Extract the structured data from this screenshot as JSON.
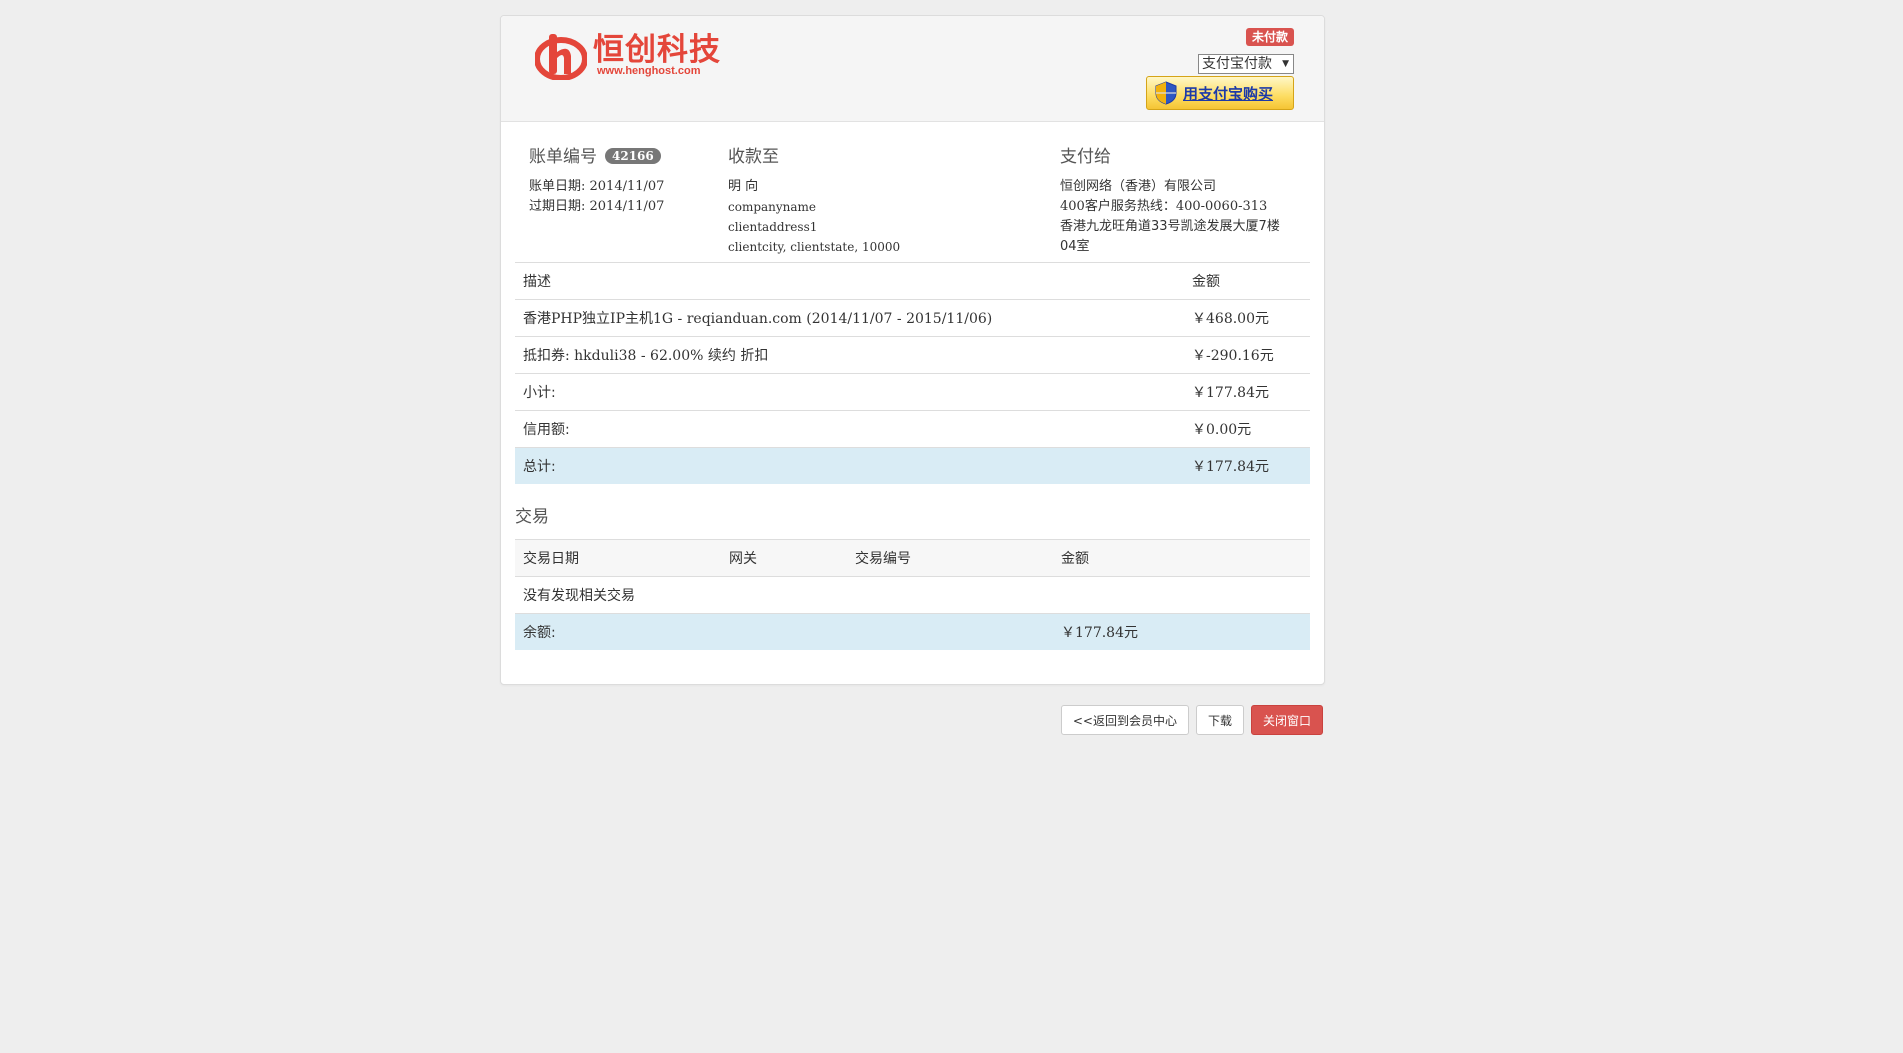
{
  "header": {
    "logo_name": "恒创科技",
    "logo_url": "www.henghost.com",
    "status": "未付款",
    "payment_method": "支付宝付款",
    "alipay_button": "用支付宝购买",
    "colors": {
      "brand": "#e4463a",
      "status": "#d9534f",
      "alipay_text": "#1c3aa8"
    }
  },
  "invoice": {
    "number_label": "账单编号",
    "number": "42166",
    "date_line": "账单日期: 2014/11/07",
    "due_line": "过期日期: 2014/11/07"
  },
  "bill_to": {
    "title": "收款至",
    "name": "明 向",
    "company": "companyname",
    "address": "clientaddress1",
    "city_line": "clientcity, clientstate, 10000"
  },
  "pay_to": {
    "title": "支付给",
    "company": "恒创网络（香港）有限公司",
    "hotline": "400客户服务热线：400-0060-313",
    "address_1": "香港九龙旺角道33号凯途发展大厦7楼",
    "address_2": "04室"
  },
  "items_table": {
    "headers": {
      "description": "描述",
      "amount": "金额"
    },
    "rows": [
      {
        "description": "香港PHP独立IP主机1G - reqianduan.com (2014/11/07 - 2015/11/06)",
        "amount": "￥468.00元"
      },
      {
        "description": "抵扣券: hkduli38 - 62.00% 续约 折扣",
        "amount": "￥-290.16元"
      }
    ],
    "subtotal": {
      "label": "小计:",
      "amount": "￥177.84元"
    },
    "credit": {
      "label": "信用额:",
      "amount": "￥0.00元"
    },
    "total": {
      "label": "总计:",
      "amount": "￥177.84元"
    }
  },
  "transactions": {
    "title": "交易",
    "headers": {
      "date": "交易日期",
      "gateway": "网关",
      "id": "交易编号",
      "amount": "金额"
    },
    "empty_text": "没有发现相关交易",
    "balance": {
      "label": "余额:",
      "amount": "￥177.84元"
    }
  },
  "actions": {
    "back": "<<返回到会员中心",
    "download": "下载",
    "close": "关闭窗口"
  }
}
